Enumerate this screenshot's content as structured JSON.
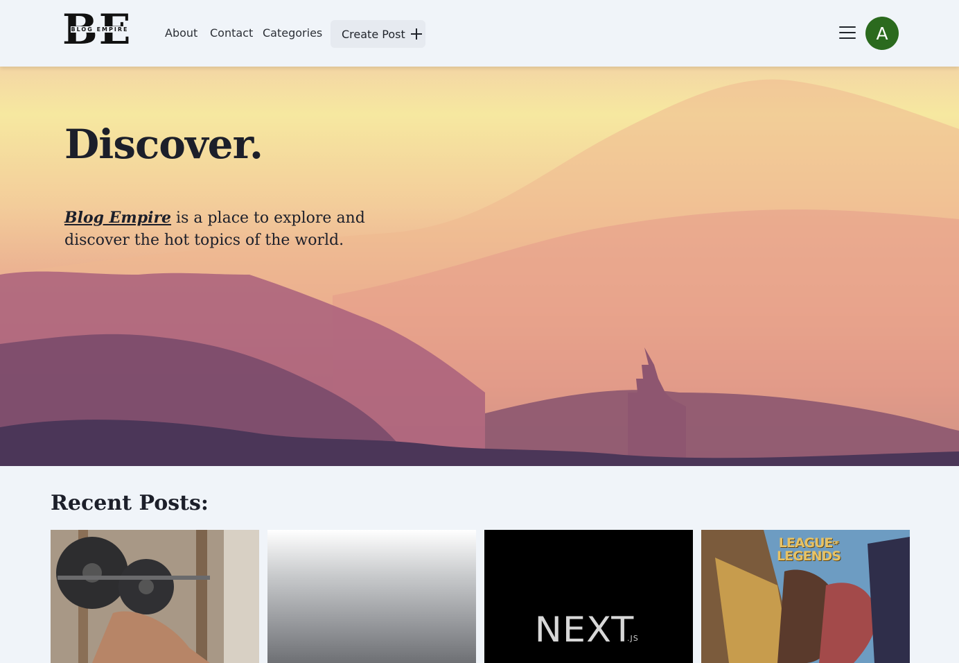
{
  "header": {
    "logo_letters": "BE",
    "logo_text": "BLOG EMPIRE",
    "nav": [
      "About",
      "Contact",
      "Categories"
    ],
    "create_label": "Create Post",
    "avatar_letter": "A"
  },
  "hero": {
    "title": "Discover.",
    "brand": "Blog Empire",
    "text": " is a place to explore and discover the hot topics of the world."
  },
  "recent": {
    "title": "Recent Posts:",
    "cards": [
      {
        "image": "gym-bench-press"
      },
      {
        "image": "gray-gradient"
      },
      {
        "image": "nextjs-logo",
        "logo": "NEXT",
        "logo_sub": ".JS"
      },
      {
        "image": "league-of-legends",
        "logo_line1": "LEAGUE",
        "logo_of": "OF",
        "logo_line2": "LEGENDS"
      }
    ]
  },
  "colors": {
    "background": "#f0f4f9",
    "avatar": "#2b6a1e",
    "text": "#1c1f2a"
  },
  "icons": [
    "plus-icon",
    "menu-icon"
  ]
}
